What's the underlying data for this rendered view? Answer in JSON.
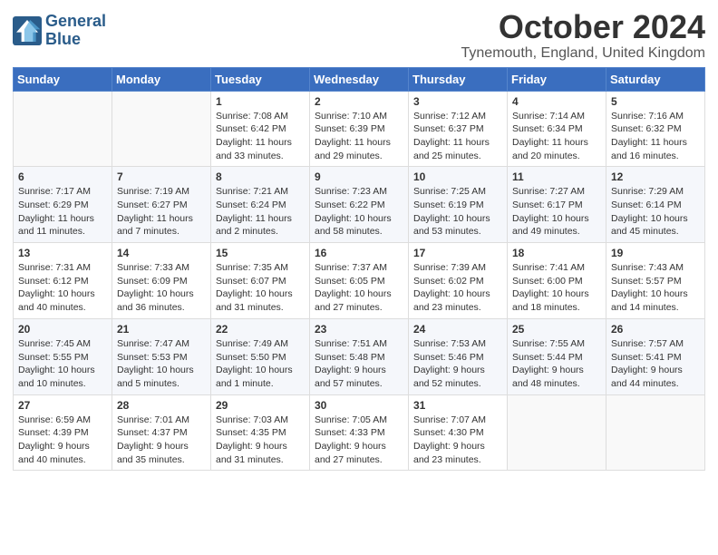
{
  "header": {
    "logo_line1": "General",
    "logo_line2": "Blue",
    "month": "October 2024",
    "location": "Tynemouth, England, United Kingdom"
  },
  "days_of_week": [
    "Sunday",
    "Monday",
    "Tuesday",
    "Wednesday",
    "Thursday",
    "Friday",
    "Saturday"
  ],
  "weeks": [
    [
      {
        "day": "",
        "detail": ""
      },
      {
        "day": "",
        "detail": ""
      },
      {
        "day": "1",
        "detail": "Sunrise: 7:08 AM\nSunset: 6:42 PM\nDaylight: 11 hours\nand 33 minutes."
      },
      {
        "day": "2",
        "detail": "Sunrise: 7:10 AM\nSunset: 6:39 PM\nDaylight: 11 hours\nand 29 minutes."
      },
      {
        "day": "3",
        "detail": "Sunrise: 7:12 AM\nSunset: 6:37 PM\nDaylight: 11 hours\nand 25 minutes."
      },
      {
        "day": "4",
        "detail": "Sunrise: 7:14 AM\nSunset: 6:34 PM\nDaylight: 11 hours\nand 20 minutes."
      },
      {
        "day": "5",
        "detail": "Sunrise: 7:16 AM\nSunset: 6:32 PM\nDaylight: 11 hours\nand 16 minutes."
      }
    ],
    [
      {
        "day": "6",
        "detail": "Sunrise: 7:17 AM\nSunset: 6:29 PM\nDaylight: 11 hours\nand 11 minutes."
      },
      {
        "day": "7",
        "detail": "Sunrise: 7:19 AM\nSunset: 6:27 PM\nDaylight: 11 hours\nand 7 minutes."
      },
      {
        "day": "8",
        "detail": "Sunrise: 7:21 AM\nSunset: 6:24 PM\nDaylight: 11 hours\nand 2 minutes."
      },
      {
        "day": "9",
        "detail": "Sunrise: 7:23 AM\nSunset: 6:22 PM\nDaylight: 10 hours\nand 58 minutes."
      },
      {
        "day": "10",
        "detail": "Sunrise: 7:25 AM\nSunset: 6:19 PM\nDaylight: 10 hours\nand 53 minutes."
      },
      {
        "day": "11",
        "detail": "Sunrise: 7:27 AM\nSunset: 6:17 PM\nDaylight: 10 hours\nand 49 minutes."
      },
      {
        "day": "12",
        "detail": "Sunrise: 7:29 AM\nSunset: 6:14 PM\nDaylight: 10 hours\nand 45 minutes."
      }
    ],
    [
      {
        "day": "13",
        "detail": "Sunrise: 7:31 AM\nSunset: 6:12 PM\nDaylight: 10 hours\nand 40 minutes."
      },
      {
        "day": "14",
        "detail": "Sunrise: 7:33 AM\nSunset: 6:09 PM\nDaylight: 10 hours\nand 36 minutes."
      },
      {
        "day": "15",
        "detail": "Sunrise: 7:35 AM\nSunset: 6:07 PM\nDaylight: 10 hours\nand 31 minutes."
      },
      {
        "day": "16",
        "detail": "Sunrise: 7:37 AM\nSunset: 6:05 PM\nDaylight: 10 hours\nand 27 minutes."
      },
      {
        "day": "17",
        "detail": "Sunrise: 7:39 AM\nSunset: 6:02 PM\nDaylight: 10 hours\nand 23 minutes."
      },
      {
        "day": "18",
        "detail": "Sunrise: 7:41 AM\nSunset: 6:00 PM\nDaylight: 10 hours\nand 18 minutes."
      },
      {
        "day": "19",
        "detail": "Sunrise: 7:43 AM\nSunset: 5:57 PM\nDaylight: 10 hours\nand 14 minutes."
      }
    ],
    [
      {
        "day": "20",
        "detail": "Sunrise: 7:45 AM\nSunset: 5:55 PM\nDaylight: 10 hours\nand 10 minutes."
      },
      {
        "day": "21",
        "detail": "Sunrise: 7:47 AM\nSunset: 5:53 PM\nDaylight: 10 hours\nand 5 minutes."
      },
      {
        "day": "22",
        "detail": "Sunrise: 7:49 AM\nSunset: 5:50 PM\nDaylight: 10 hours\nand 1 minute."
      },
      {
        "day": "23",
        "detail": "Sunrise: 7:51 AM\nSunset: 5:48 PM\nDaylight: 9 hours\nand 57 minutes."
      },
      {
        "day": "24",
        "detail": "Sunrise: 7:53 AM\nSunset: 5:46 PM\nDaylight: 9 hours\nand 52 minutes."
      },
      {
        "day": "25",
        "detail": "Sunrise: 7:55 AM\nSunset: 5:44 PM\nDaylight: 9 hours\nand 48 minutes."
      },
      {
        "day": "26",
        "detail": "Sunrise: 7:57 AM\nSunset: 5:41 PM\nDaylight: 9 hours\nand 44 minutes."
      }
    ],
    [
      {
        "day": "27",
        "detail": "Sunrise: 6:59 AM\nSunset: 4:39 PM\nDaylight: 9 hours\nand 40 minutes."
      },
      {
        "day": "28",
        "detail": "Sunrise: 7:01 AM\nSunset: 4:37 PM\nDaylight: 9 hours\nand 35 minutes."
      },
      {
        "day": "29",
        "detail": "Sunrise: 7:03 AM\nSunset: 4:35 PM\nDaylight: 9 hours\nand 31 minutes."
      },
      {
        "day": "30",
        "detail": "Sunrise: 7:05 AM\nSunset: 4:33 PM\nDaylight: 9 hours\nand 27 minutes."
      },
      {
        "day": "31",
        "detail": "Sunrise: 7:07 AM\nSunset: 4:30 PM\nDaylight: 9 hours\nand 23 minutes."
      },
      {
        "day": "",
        "detail": ""
      },
      {
        "day": "",
        "detail": ""
      }
    ]
  ]
}
